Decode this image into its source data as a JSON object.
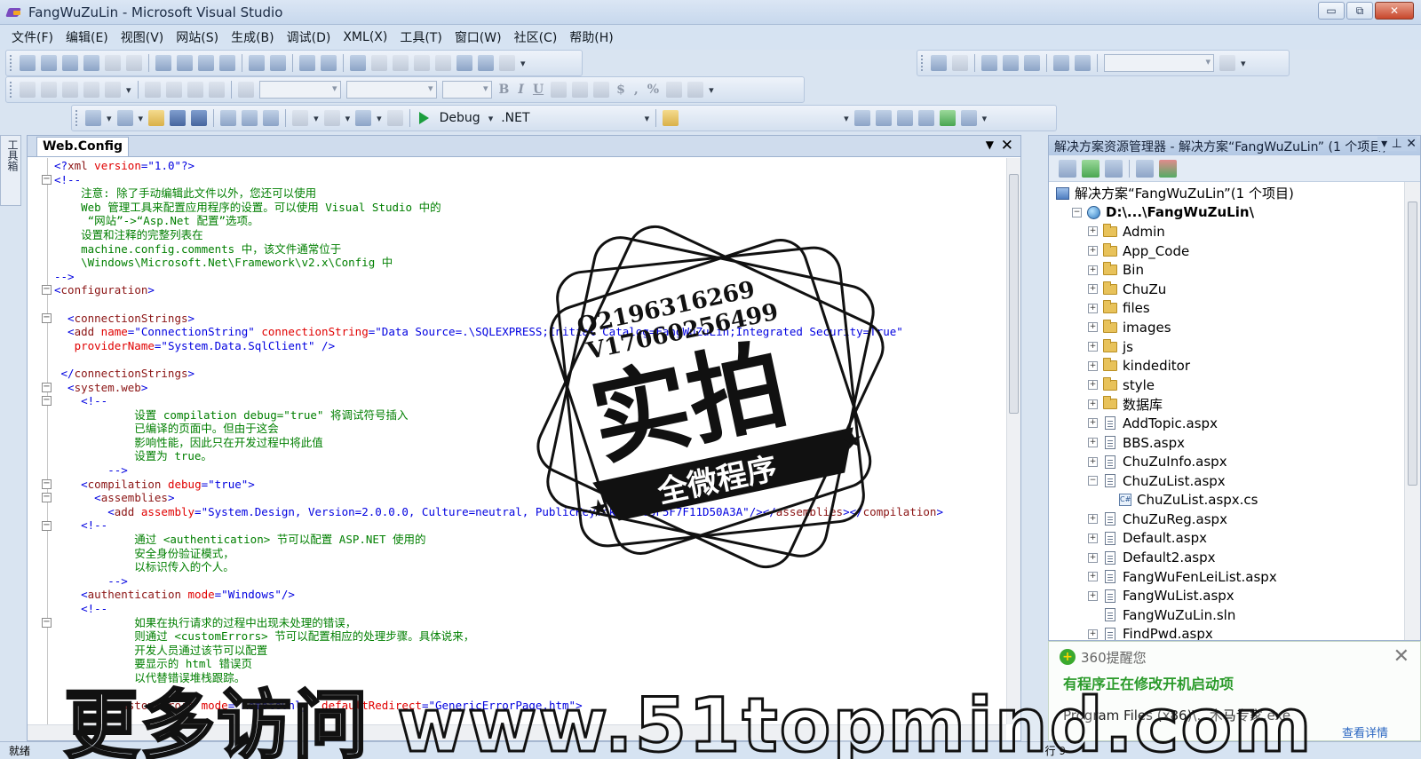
{
  "window": {
    "title": "FangWuZuLin - Microsoft Visual Studio",
    "minimize": "▭",
    "restore": "⧉",
    "close": "✕"
  },
  "menu": [
    "文件(F)",
    "编辑(E)",
    "视图(V)",
    "网站(S)",
    "生成(B)",
    "调试(D)",
    "XML(X)",
    "工具(T)",
    "窗口(W)",
    "社区(C)",
    "帮助(H)"
  ],
  "toolbar": {
    "config": "Debug",
    "platform": ".NET",
    "bold": "B",
    "italic": "I",
    "underline": "U",
    "currency": "$",
    "comma": ",",
    "percent": "%"
  },
  "toolbox_label": "工具箱",
  "editor": {
    "tab_title": "Web.Config",
    "tab_dropdown": "▼",
    "tab_close": "✕",
    "lines": [
      [
        [
          "p",
          "<?"
        ],
        [
          "t",
          "xml"
        ],
        [
          "a",
          " version"
        ],
        [
          "p",
          "="
        ],
        [
          "v",
          "\"1.0\""
        ],
        [
          "p",
          "?>"
        ]
      ],
      [
        [
          "p",
          "<!--"
        ]
      ],
      [
        [
          "c",
          "    注意: 除了手动编辑此文件以外，您还可以使用"
        ]
      ],
      [
        [
          "c",
          "    Web 管理工具来配置应用程序的设置。可以使用 Visual Studio 中的"
        ]
      ],
      [
        [
          "c",
          "     “网站”->“Asp.Net 配置”选项。"
        ]
      ],
      [
        [
          "c",
          "    设置和注释的完整列表在"
        ]
      ],
      [
        [
          "c",
          "    machine.config.comments 中，该文件通常位于"
        ]
      ],
      [
        [
          "c",
          "    \\Windows\\Microsoft.Net\\Framework\\v2.x\\Config 中"
        ]
      ],
      [
        [
          "p",
          "-->"
        ]
      ],
      [
        [
          "p",
          "<"
        ],
        [
          "t",
          "configuration"
        ],
        [
          "p",
          ">"
        ]
      ],
      [
        [
          "p",
          ""
        ]
      ],
      [
        [
          "p",
          "  <"
        ],
        [
          "t",
          "connectionStrings"
        ],
        [
          "p",
          ">"
        ]
      ],
      [
        [
          "p",
          "  <"
        ],
        [
          "t",
          "add"
        ],
        [
          "a",
          " name"
        ],
        [
          "p",
          "="
        ],
        [
          "v",
          "\"ConnectionString\""
        ],
        [
          "a",
          " connectionString"
        ],
        [
          "p",
          "="
        ],
        [
          "v",
          "\"Data Source=.\\SQLEXPRESS;Initial Catalog=FangWuZuLin;Integrated Security=True\""
        ]
      ],
      [
        [
          "a",
          "   providerName"
        ],
        [
          "p",
          "="
        ],
        [
          "v",
          "\"System.Data.SqlClient\""
        ],
        [
          "p",
          " />"
        ]
      ],
      [
        [
          "p",
          ""
        ]
      ],
      [
        [
          "p",
          " </"
        ],
        [
          "t",
          "connectionStrings"
        ],
        [
          "p",
          ">"
        ]
      ],
      [
        [
          "p",
          "  <"
        ],
        [
          "t",
          "system.web"
        ],
        [
          "p",
          ">"
        ]
      ],
      [
        [
          "p",
          "    <!--"
        ]
      ],
      [
        [
          "c",
          "            设置 compilation debug=\"true\" 将调试符号插入"
        ]
      ],
      [
        [
          "c",
          "            已编译的页面中。但由于这会"
        ]
      ],
      [
        [
          "c",
          "            影响性能，因此只在开发过程中将此值"
        ]
      ],
      [
        [
          "c",
          "            设置为 true。"
        ]
      ],
      [
        [
          "p",
          "        -->"
        ]
      ],
      [
        [
          "p",
          "    <"
        ],
        [
          "t",
          "compilation"
        ],
        [
          "a",
          " debug"
        ],
        [
          "p",
          "="
        ],
        [
          "v",
          "\"true\""
        ],
        [
          "p",
          ">"
        ]
      ],
      [
        [
          "p",
          "      <"
        ],
        [
          "t",
          "assemblies"
        ],
        [
          "p",
          ">"
        ]
      ],
      [
        [
          "p",
          "        <"
        ],
        [
          "t",
          "add"
        ],
        [
          "a",
          " assembly"
        ],
        [
          "p",
          "="
        ],
        [
          "v",
          "\"System.Design, Version=2.0.0.0, Culture=neutral, PublicKeyToken=B03F5F7F11D50A3A\""
        ],
        [
          "p",
          "/></"
        ],
        [
          "t",
          "assemblies"
        ],
        [
          "p",
          "></"
        ],
        [
          "t",
          "compilation"
        ],
        [
          "p",
          ">"
        ]
      ],
      [
        [
          "p",
          "    <!--"
        ]
      ],
      [
        [
          "c",
          "            通过 <authentication> 节可以配置 ASP.NET 使用的"
        ]
      ],
      [
        [
          "c",
          "            安全身份验证模式，"
        ]
      ],
      [
        [
          "c",
          "            以标识传入的个人。"
        ]
      ],
      [
        [
          "p",
          "        -->"
        ]
      ],
      [
        [
          "p",
          "    <"
        ],
        [
          "t",
          "authentication"
        ],
        [
          "a",
          " mode"
        ],
        [
          "p",
          "="
        ],
        [
          "v",
          "\"Windows\""
        ],
        [
          "p",
          "/>"
        ]
      ],
      [
        [
          "p",
          "    <!--"
        ]
      ],
      [
        [
          "c",
          "            如果在执行请求的过程中出现未处理的错误，"
        ]
      ],
      [
        [
          "c",
          "            则通过 <customErrors> 节可以配置相应的处理步骤。具体说来，"
        ]
      ],
      [
        [
          "c",
          "            开发人员通过该节可以配置"
        ]
      ],
      [
        [
          "c",
          "            要显示的 html 错误页"
        ]
      ],
      [
        [
          "c",
          "            以代替错误堆栈跟踪。"
        ]
      ],
      [
        [
          "p",
          ""
        ]
      ],
      [
        [
          "p",
          "        <"
        ],
        [
          "t",
          "customErrors"
        ],
        [
          "a",
          " mode"
        ],
        [
          "p",
          "="
        ],
        [
          "v",
          "\"RemoteOnly\""
        ],
        [
          "a",
          " defaultRedirect"
        ],
        [
          "p",
          "="
        ],
        [
          "v",
          "\"GenericErrorPage.htm\""
        ],
        [
          "p",
          ">"
        ]
      ]
    ]
  },
  "solution_explorer": {
    "title": "解决方案资源管理器 - 解决方案“FangWuZuLin” (1 个项目)",
    "header_buttons": "▾ ⊥ ✕",
    "items": [
      {
        "label": "解决方案“FangWuZuLin”(1 个项目)",
        "icon": "solution",
        "indent": 0,
        "exp": ""
      },
      {
        "label": "D:\\...\\FangWuZuLin\\",
        "icon": "project",
        "indent": 1,
        "exp": "−",
        "bold": true
      },
      {
        "label": "Admin",
        "icon": "folder",
        "indent": 2,
        "exp": "+"
      },
      {
        "label": "App_Code",
        "icon": "folder",
        "indent": 2,
        "exp": "+"
      },
      {
        "label": "Bin",
        "icon": "folder",
        "indent": 2,
        "exp": "+"
      },
      {
        "label": "ChuZu",
        "icon": "folder",
        "indent": 2,
        "exp": "+"
      },
      {
        "label": "files",
        "icon": "folder",
        "indent": 2,
        "exp": "+"
      },
      {
        "label": "images",
        "icon": "folder",
        "indent": 2,
        "exp": "+"
      },
      {
        "label": "js",
        "icon": "folder",
        "indent": 2,
        "exp": "+"
      },
      {
        "label": "kindeditor",
        "icon": "folder",
        "indent": 2,
        "exp": "+"
      },
      {
        "label": "style",
        "icon": "folder",
        "indent": 2,
        "exp": "+"
      },
      {
        "label": "数据库",
        "icon": "folder",
        "indent": 2,
        "exp": "+"
      },
      {
        "label": "AddTopic.aspx",
        "icon": "file",
        "indent": 2,
        "exp": "+"
      },
      {
        "label": "BBS.aspx",
        "icon": "file",
        "indent": 2,
        "exp": "+"
      },
      {
        "label": "ChuZuInfo.aspx",
        "icon": "file",
        "indent": 2,
        "exp": "+"
      },
      {
        "label": "ChuZuList.aspx",
        "icon": "file",
        "indent": 2,
        "exp": "−"
      },
      {
        "label": "ChuZuList.aspx.cs",
        "icon": "cs",
        "indent": 3,
        "exp": ""
      },
      {
        "label": "ChuZuReg.aspx",
        "icon": "file",
        "indent": 2,
        "exp": "+"
      },
      {
        "label": "Default.aspx",
        "icon": "file",
        "indent": 2,
        "exp": "+"
      },
      {
        "label": "Default2.aspx",
        "icon": "file",
        "indent": 2,
        "exp": "+"
      },
      {
        "label": "FangWuFenLeiList.aspx",
        "icon": "file",
        "indent": 2,
        "exp": "+"
      },
      {
        "label": "FangWuList.aspx",
        "icon": "file",
        "indent": 2,
        "exp": "+"
      },
      {
        "label": "FangWuZuLin.sln",
        "icon": "file",
        "indent": 2,
        "exp": ""
      },
      {
        "label": "FindPwd.aspx",
        "icon": "file",
        "indent": 2,
        "exp": "+"
      }
    ]
  },
  "popup": {
    "brand": "360提醒您",
    "title": "有程序正在修改开机启动项",
    "body": "Program Files (x86)\\...木马专家.exe",
    "link": "查看详情",
    "close": "✕"
  },
  "status": {
    "left": "就绪",
    "right": "行 9"
  },
  "watermark": {
    "contact_q": "Q2196316269",
    "contact_v": "V17060256499",
    "main": "实拍",
    "ribbon": "全微程序",
    "banner": "更多访问 www.51topmind.com"
  }
}
